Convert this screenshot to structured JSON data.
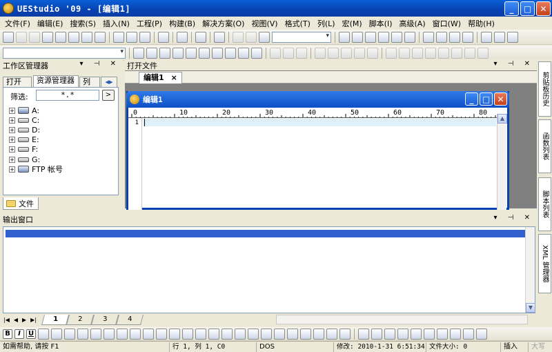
{
  "window": {
    "title": "UEStudio '09 - [编辑1]",
    "controls": [
      "minimize-icon",
      "maximize-icon",
      "close-icon"
    ]
  },
  "menu": [
    "文件(F)",
    "编辑(E)",
    "搜索(S)",
    "插入(N)",
    "工程(P)",
    "构建(B)",
    "解决方案(O)",
    "视图(V)",
    "格式(T)",
    "列(L)",
    "宏(M)",
    "脚本(I)",
    "高级(A)",
    "窗口(W)",
    "帮助(H)"
  ],
  "workspace": {
    "title": "工作区管理器",
    "tabs": [
      "打开",
      "资源管理器",
      "列表"
    ],
    "active_tab": "资源管理器",
    "filter_label": "筛选:",
    "filter_value": "*.*",
    "filter_button": ">",
    "tree": [
      "A:",
      "C:",
      "D:",
      "E:",
      "F:",
      "G:",
      "FTP 帐号"
    ],
    "bottom_tab": "文件"
  },
  "open_files": {
    "title": "打开文件",
    "tab": "编辑1",
    "tab_close": "×"
  },
  "editor": {
    "title": "编辑1",
    "ruler_labels": [
      "0",
      "10",
      "20",
      "30",
      "40",
      "50",
      "60",
      "70",
      "80"
    ],
    "line_number": "1"
  },
  "right_dock_tabs": [
    "剪贴板历史",
    "函数列表",
    "脚本列表",
    "XML 管理器"
  ],
  "output": {
    "title": "输出窗口",
    "sheet_tabs": [
      "1",
      "2",
      "3",
      "4"
    ],
    "active_sheet": "1"
  },
  "statusbar": {
    "help": "如需帮助, 请按 F1",
    "position": "行 1, 列 1, C0",
    "format": "DOS",
    "modified": "修改: 2010-1-31 6:51:34",
    "filesize": "文件大小: 0",
    "mode": "插入",
    "caps": "大写"
  },
  "colors": {
    "titlebar": "#0a5fd8",
    "selection": "#3160cf",
    "current_line": "#dff0fa"
  }
}
